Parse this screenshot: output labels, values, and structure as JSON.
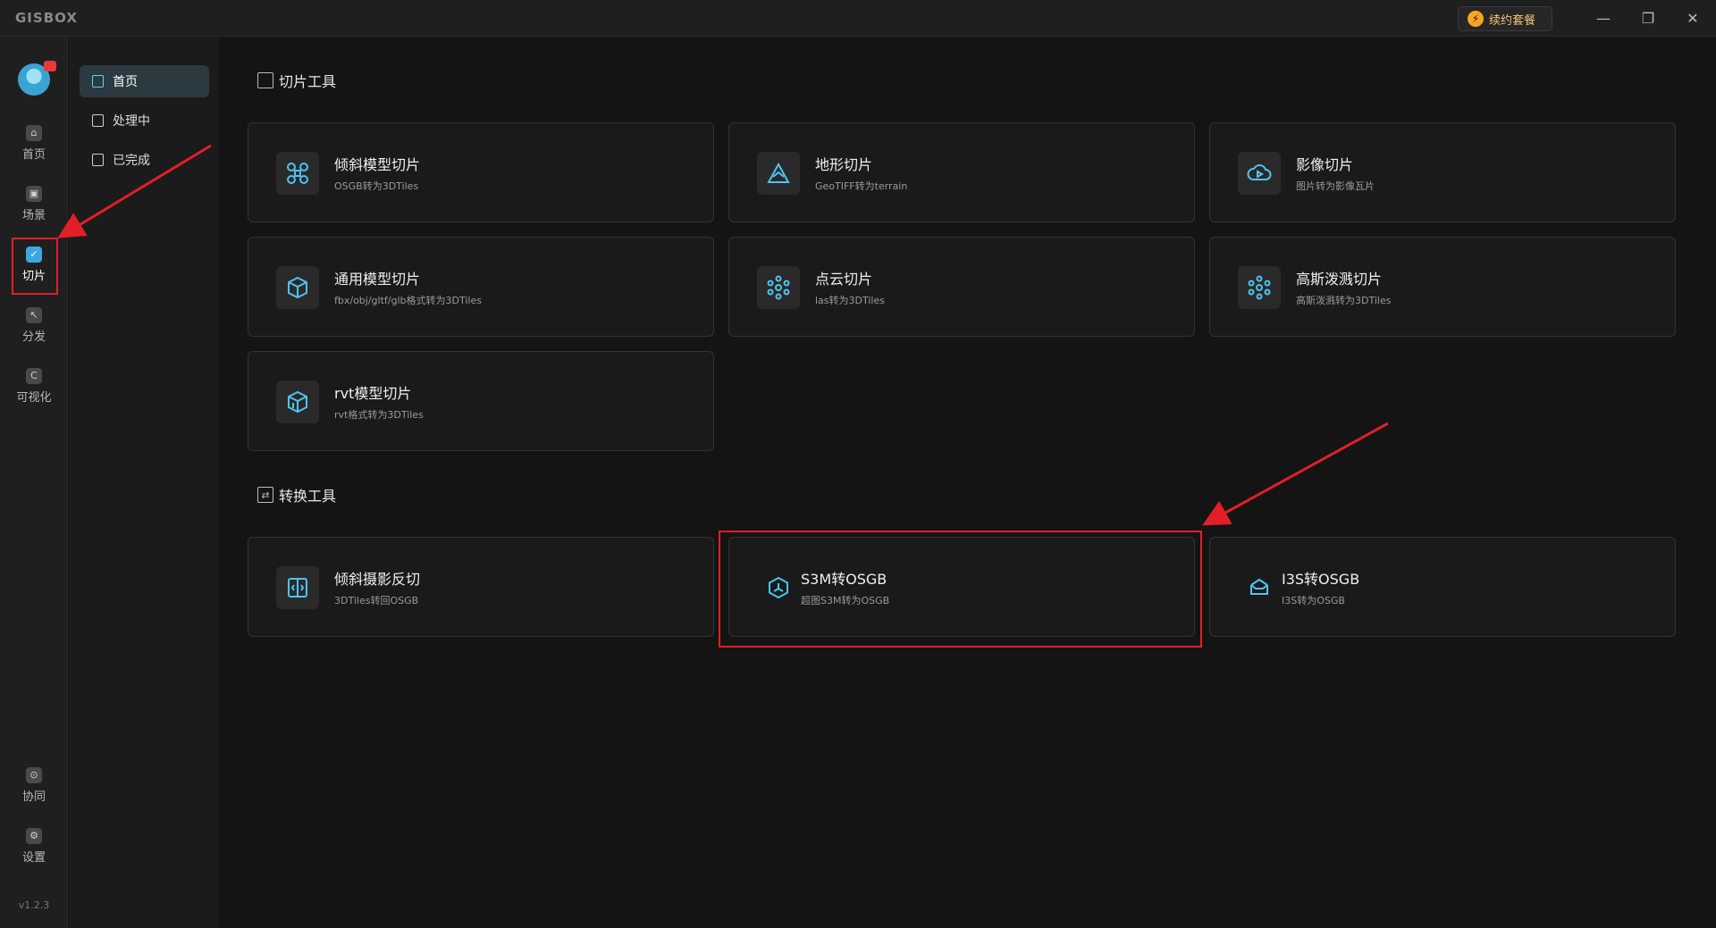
{
  "app": {
    "logo": "GISBOX",
    "version": "v1.2.3"
  },
  "titlebar": {
    "package_label": "续约套餐",
    "package_icon": "⚡",
    "minimize": "—",
    "maximize": "❐",
    "close": "✕"
  },
  "rail": {
    "items": [
      {
        "label": "首页",
        "icon": "⌂"
      },
      {
        "label": "场景",
        "icon": "▣"
      },
      {
        "label": "切片",
        "icon": "✓"
      },
      {
        "label": "分发",
        "icon": "↖"
      },
      {
        "label": "可视化",
        "icon": "C"
      },
      {
        "label": "协同",
        "icon": "⊙"
      },
      {
        "label": "设置",
        "icon": "⚙"
      }
    ]
  },
  "subnav": {
    "items": [
      {
        "label": "首页"
      },
      {
        "label": "处理中"
      },
      {
        "label": "已完成"
      }
    ]
  },
  "sections": {
    "slicing": {
      "title": "切片工具"
    },
    "conversion": {
      "title": "转换工具"
    }
  },
  "cards": [
    {
      "title": "倾斜模型切片",
      "sub": "OSGB转为3DTiles",
      "icon": "drone-icon"
    },
    {
      "title": "地形切片",
      "sub": "GeoTIFF转为terrain",
      "icon": "terrain-icon"
    },
    {
      "title": "影像切片",
      "sub": "图片转为影像瓦片",
      "icon": "cloud-play-icon"
    },
    {
      "title": "通用模型切片",
      "sub": "fbx/obj/gltf/glb格式转为3DTiles",
      "icon": "cube-icon"
    },
    {
      "title": "点云切片",
      "sub": "las转为3DTiles",
      "icon": "point-cloud-icon"
    },
    {
      "title": "高斯泼溅切片",
      "sub": "高斯泼溅转为3DTiles",
      "icon": "gaussian-icon"
    },
    {
      "title": "rvt模型切片",
      "sub": "rvt格式转为3DTiles",
      "icon": "rvt-cube-icon"
    },
    {
      "title": "倾斜摄影反切",
      "sub": "3DTiles转回OSGB",
      "icon": "reverse-icon"
    },
    {
      "title": "S3M转OSGB",
      "sub": "超图S3M转为OSGB",
      "icon": "hexagon-icon"
    },
    {
      "title": "I3S转OSGB",
      "sub": "I3S转为OSGB",
      "icon": "box-open-icon"
    }
  ],
  "colors": {
    "accent": "#3da8e0",
    "icon_stroke": "#4fc3f0",
    "highlight": "#e21f26",
    "background": "#141414"
  }
}
